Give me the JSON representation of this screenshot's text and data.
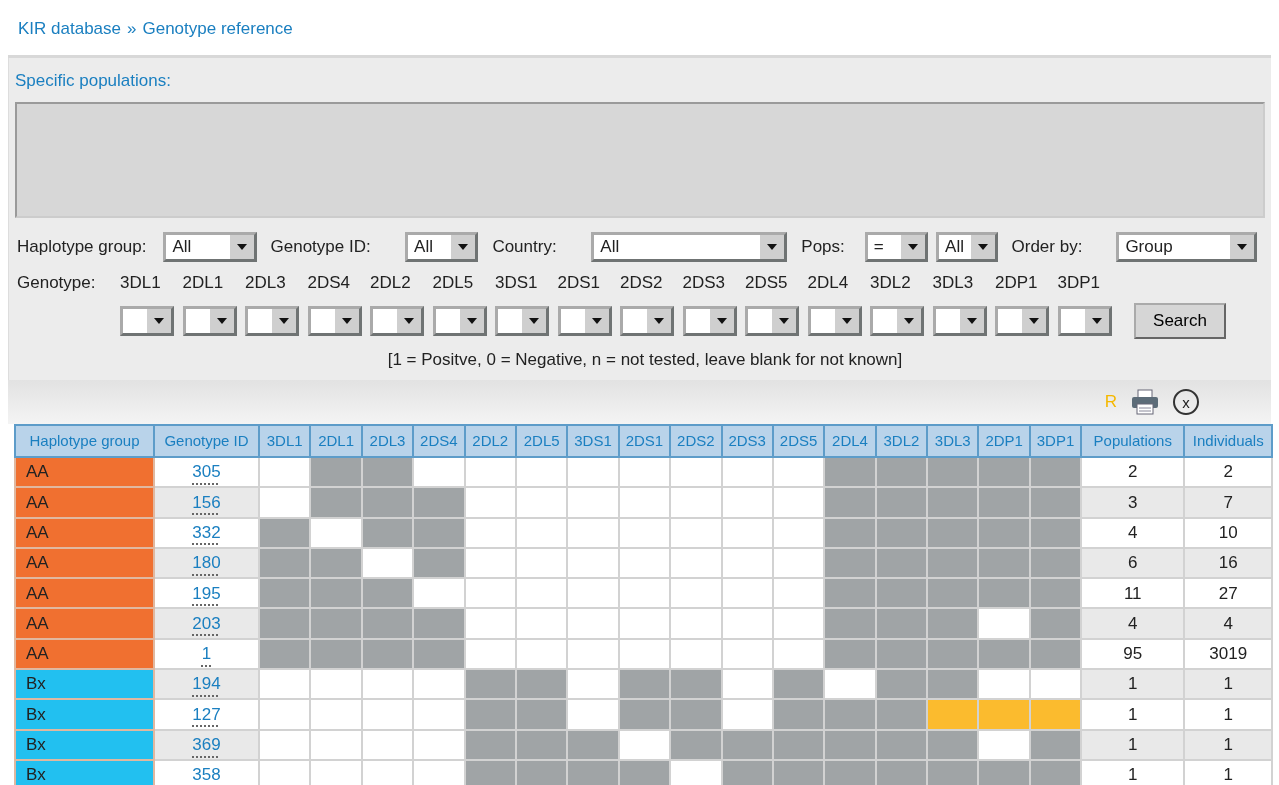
{
  "breadcrumb": {
    "items": [
      "KIR database",
      "Genotype reference"
    ],
    "separator": "»"
  },
  "populations": {
    "label": "Specific populations:"
  },
  "filters": [
    {
      "label": "Haplotype group:",
      "selects": [
        "All"
      ]
    },
    {
      "label": "Genotype ID:",
      "selects": [
        "All"
      ]
    },
    {
      "label": "Country:",
      "selects": [
        "All"
      ]
    },
    {
      "label": "Pops:",
      "selects": [
        "=",
        "All"
      ]
    },
    {
      "label": "Order by:",
      "selects": [
        "Group"
      ]
    }
  ],
  "genotype": {
    "label": "Genotype:",
    "genes": [
      "3DL1",
      "2DL1",
      "2DL3",
      "2DS4",
      "2DL2",
      "2DL5",
      "3DS1",
      "2DS1",
      "2DS2",
      "2DS3",
      "2DS5",
      "2DL4",
      "3DL2",
      "3DL3",
      "2DP1",
      "3DP1"
    ]
  },
  "search_button": "Search",
  "note": "[1 = Positve, 0 = Negative, n = not tested, leave blank for not known]",
  "toolbar": {
    "r_label": "R",
    "close": "x"
  },
  "table": {
    "columns": [
      "Haplotype group",
      "Genotype ID",
      "3DL1",
      "2DL1",
      "2DL3",
      "2DS4",
      "2DL2",
      "2DL5",
      "3DS1",
      "2DS1",
      "2DS2",
      "2DS3",
      "2DS5",
      "2DL4",
      "3DL2",
      "3DL3",
      "2DP1",
      "3DP1",
      "Populations",
      "Individuals"
    ],
    "rows": [
      {
        "group": "AA",
        "color": "#f07030",
        "id": "305",
        "cells": [
          {
            "on": false,
            "highlighted": false
          },
          {
            "on": true,
            "highlighted": false
          },
          {
            "on": true,
            "highlighted": false
          },
          {
            "on": false,
            "highlighted": false
          },
          {
            "on": false,
            "highlighted": false
          },
          {
            "on": false,
            "highlighted": false
          },
          {
            "on": false,
            "highlighted": false
          },
          {
            "on": false,
            "highlighted": false
          },
          {
            "on": false,
            "highlighted": false
          },
          {
            "on": false,
            "highlighted": false
          },
          {
            "on": false,
            "highlighted": false
          },
          {
            "on": true,
            "highlighted": false
          },
          {
            "on": true,
            "highlighted": false
          },
          {
            "on": true,
            "highlighted": false
          },
          {
            "on": true,
            "highlighted": false
          },
          {
            "on": true,
            "highlighted": false
          }
        ],
        "populations": "2",
        "individuals": "2"
      },
      {
        "group": "AA",
        "color": "#f07030",
        "id": "156",
        "cells": [
          {
            "on": false,
            "highlighted": false
          },
          {
            "on": true,
            "highlighted": false
          },
          {
            "on": true,
            "highlighted": false
          },
          {
            "on": true,
            "highlighted": false
          },
          {
            "on": false,
            "highlighted": false
          },
          {
            "on": false,
            "highlighted": false
          },
          {
            "on": false,
            "highlighted": false
          },
          {
            "on": false,
            "highlighted": false
          },
          {
            "on": false,
            "highlighted": false
          },
          {
            "on": false,
            "highlighted": false
          },
          {
            "on": false,
            "highlighted": false
          },
          {
            "on": true,
            "highlighted": false
          },
          {
            "on": true,
            "highlighted": false
          },
          {
            "on": true,
            "highlighted": false
          },
          {
            "on": true,
            "highlighted": false
          },
          {
            "on": true,
            "highlighted": false
          }
        ],
        "populations": "3",
        "individuals": "7"
      },
      {
        "group": "AA",
        "color": "#f07030",
        "id": "332",
        "cells": [
          {
            "on": true,
            "highlighted": false
          },
          {
            "on": false,
            "highlighted": false
          },
          {
            "on": true,
            "highlighted": false
          },
          {
            "on": true,
            "highlighted": false
          },
          {
            "on": false,
            "highlighted": false
          },
          {
            "on": false,
            "highlighted": false
          },
          {
            "on": false,
            "highlighted": false
          },
          {
            "on": false,
            "highlighted": false
          },
          {
            "on": false,
            "highlighted": false
          },
          {
            "on": false,
            "highlighted": false
          },
          {
            "on": false,
            "highlighted": false
          },
          {
            "on": true,
            "highlighted": false
          },
          {
            "on": true,
            "highlighted": false
          },
          {
            "on": true,
            "highlighted": false
          },
          {
            "on": true,
            "highlighted": false
          },
          {
            "on": true,
            "highlighted": false
          }
        ],
        "populations": "4",
        "individuals": "10"
      },
      {
        "group": "AA",
        "color": "#f07030",
        "id": "180",
        "cells": [
          {
            "on": true,
            "highlighted": false
          },
          {
            "on": true,
            "highlighted": false
          },
          {
            "on": false,
            "highlighted": false
          },
          {
            "on": true,
            "highlighted": false
          },
          {
            "on": false,
            "highlighted": false
          },
          {
            "on": false,
            "highlighted": false
          },
          {
            "on": false,
            "highlighted": false
          },
          {
            "on": false,
            "highlighted": false
          },
          {
            "on": false,
            "highlighted": false
          },
          {
            "on": false,
            "highlighted": false
          },
          {
            "on": false,
            "highlighted": false
          },
          {
            "on": true,
            "highlighted": false
          },
          {
            "on": true,
            "highlighted": false
          },
          {
            "on": true,
            "highlighted": false
          },
          {
            "on": true,
            "highlighted": false
          },
          {
            "on": true,
            "highlighted": false
          }
        ],
        "populations": "6",
        "individuals": "16"
      },
      {
        "group": "AA",
        "color": "#f07030",
        "id": "195",
        "cells": [
          {
            "on": true,
            "highlighted": false
          },
          {
            "on": true,
            "highlighted": false
          },
          {
            "on": true,
            "highlighted": false
          },
          {
            "on": false,
            "highlighted": false
          },
          {
            "on": false,
            "highlighted": false
          },
          {
            "on": false,
            "highlighted": false
          },
          {
            "on": false,
            "highlighted": false
          },
          {
            "on": false,
            "highlighted": false
          },
          {
            "on": false,
            "highlighted": false
          },
          {
            "on": false,
            "highlighted": false
          },
          {
            "on": false,
            "highlighted": false
          },
          {
            "on": true,
            "highlighted": false
          },
          {
            "on": true,
            "highlighted": false
          },
          {
            "on": true,
            "highlighted": false
          },
          {
            "on": true,
            "highlighted": false
          },
          {
            "on": true,
            "highlighted": false
          }
        ],
        "populations": "11",
        "individuals": "27"
      },
      {
        "group": "AA",
        "color": "#f07030",
        "id": "203",
        "cells": [
          {
            "on": true,
            "highlighted": false
          },
          {
            "on": true,
            "highlighted": false
          },
          {
            "on": true,
            "highlighted": false
          },
          {
            "on": true,
            "highlighted": false
          },
          {
            "on": false,
            "highlighted": false
          },
          {
            "on": false,
            "highlighted": false
          },
          {
            "on": false,
            "highlighted": false
          },
          {
            "on": false,
            "highlighted": false
          },
          {
            "on": false,
            "highlighted": false
          },
          {
            "on": false,
            "highlighted": false
          },
          {
            "on": false,
            "highlighted": false
          },
          {
            "on": true,
            "highlighted": false
          },
          {
            "on": true,
            "highlighted": false
          },
          {
            "on": true,
            "highlighted": false
          },
          {
            "on": false,
            "highlighted": false
          },
          {
            "on": true,
            "highlighted": false
          }
        ],
        "populations": "4",
        "individuals": "4"
      },
      {
        "group": "AA",
        "color": "#f07030",
        "id": "1",
        "cells": [
          {
            "on": true,
            "highlighted": false
          },
          {
            "on": true,
            "highlighted": false
          },
          {
            "on": true,
            "highlighted": false
          },
          {
            "on": true,
            "highlighted": false
          },
          {
            "on": false,
            "highlighted": false
          },
          {
            "on": false,
            "highlighted": false
          },
          {
            "on": false,
            "highlighted": false
          },
          {
            "on": false,
            "highlighted": false
          },
          {
            "on": false,
            "highlighted": false
          },
          {
            "on": false,
            "highlighted": false
          },
          {
            "on": false,
            "highlighted": false
          },
          {
            "on": true,
            "highlighted": false
          },
          {
            "on": true,
            "highlighted": false
          },
          {
            "on": true,
            "highlighted": false
          },
          {
            "on": true,
            "highlighted": false
          },
          {
            "on": true,
            "highlighted": false
          }
        ],
        "populations": "95",
        "individuals": "3019"
      },
      {
        "group": "Bx",
        "color": "#22c0f0",
        "id": "194",
        "cells": [
          {
            "on": false,
            "highlighted": false
          },
          {
            "on": false,
            "highlighted": false
          },
          {
            "on": false,
            "highlighted": false
          },
          {
            "on": false,
            "highlighted": false
          },
          {
            "on": true,
            "highlighted": false
          },
          {
            "on": true,
            "highlighted": false
          },
          {
            "on": false,
            "highlighted": false
          },
          {
            "on": true,
            "highlighted": false
          },
          {
            "on": true,
            "highlighted": false
          },
          {
            "on": false,
            "highlighted": false
          },
          {
            "on": true,
            "highlighted": false
          },
          {
            "on": false,
            "highlighted": false
          },
          {
            "on": true,
            "highlighted": false
          },
          {
            "on": true,
            "highlighted": false
          },
          {
            "on": false,
            "highlighted": false
          },
          {
            "on": false,
            "highlighted": false
          }
        ],
        "populations": "1",
        "individuals": "1"
      },
      {
        "group": "Bx",
        "color": "#22c0f0",
        "id": "127",
        "cells": [
          {
            "on": false,
            "highlighted": false
          },
          {
            "on": false,
            "highlighted": false
          },
          {
            "on": false,
            "highlighted": false
          },
          {
            "on": false,
            "highlighted": false
          },
          {
            "on": true,
            "highlighted": false
          },
          {
            "on": true,
            "highlighted": false
          },
          {
            "on": false,
            "highlighted": false
          },
          {
            "on": true,
            "highlighted": false
          },
          {
            "on": true,
            "highlighted": false
          },
          {
            "on": false,
            "highlighted": false
          },
          {
            "on": true,
            "highlighted": false
          },
          {
            "on": true,
            "highlighted": false
          },
          {
            "on": true,
            "highlighted": false
          },
          {
            "on": true,
            "highlighted": true
          },
          {
            "on": true,
            "highlighted": true
          },
          {
            "on": true,
            "highlighted": true
          }
        ],
        "populations": "1",
        "individuals": "1"
      },
      {
        "group": "Bx",
        "color": "#22c0f0",
        "id": "369",
        "cells": [
          {
            "on": false,
            "highlighted": false
          },
          {
            "on": false,
            "highlighted": false
          },
          {
            "on": false,
            "highlighted": false
          },
          {
            "on": false,
            "highlighted": false
          },
          {
            "on": true,
            "highlighted": false
          },
          {
            "on": true,
            "highlighted": false
          },
          {
            "on": true,
            "highlighted": false
          },
          {
            "on": false,
            "highlighted": false
          },
          {
            "on": true,
            "highlighted": false
          },
          {
            "on": true,
            "highlighted": false
          },
          {
            "on": true,
            "highlighted": false
          },
          {
            "on": true,
            "highlighted": false
          },
          {
            "on": true,
            "highlighted": false
          },
          {
            "on": true,
            "highlighted": false
          },
          {
            "on": false,
            "highlighted": false
          },
          {
            "on": true,
            "highlighted": false
          }
        ],
        "populations": "1",
        "individuals": "1"
      },
      {
        "group": "Bx",
        "color": "#22c0f0",
        "id": "358",
        "cells": [
          {
            "on": false,
            "highlighted": false
          },
          {
            "on": false,
            "highlighted": false
          },
          {
            "on": false,
            "highlighted": false
          },
          {
            "on": false,
            "highlighted": false
          },
          {
            "on": true,
            "highlighted": false
          },
          {
            "on": true,
            "highlighted": false
          },
          {
            "on": true,
            "highlighted": false
          },
          {
            "on": true,
            "highlighted": false
          },
          {
            "on": false,
            "highlighted": false
          },
          {
            "on": true,
            "highlighted": false
          },
          {
            "on": true,
            "highlighted": false
          },
          {
            "on": true,
            "highlighted": false
          },
          {
            "on": true,
            "highlighted": false
          },
          {
            "on": true,
            "highlighted": false
          },
          {
            "on": true,
            "highlighted": false
          },
          {
            "on": true,
            "highlighted": false
          }
        ],
        "populations": "1",
        "individuals": "1"
      }
    ]
  }
}
